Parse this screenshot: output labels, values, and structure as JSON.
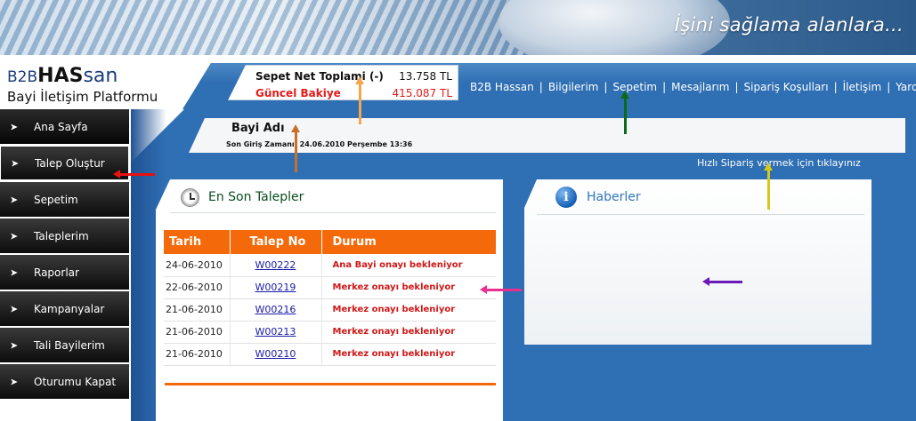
{
  "banner": {
    "slogan": "İşini sağlama alanlara..."
  },
  "logo": {
    "prefix": "B2B",
    "brand_bold": "HAS",
    "brand_light": "san",
    "subtitle": "Bayi İletişim Platformu"
  },
  "cart": {
    "net_total_label": "Sepet Net Toplami (-)",
    "net_total_value": "13.758 TL",
    "balance_label": "Güncel Bakiye",
    "balance_value": "415.087 TL"
  },
  "topnav": {
    "items": [
      "B2B Hassan",
      "Bilgilerim",
      "Sepetim",
      "Mesajlarım",
      "Sipariş Koşulları",
      "İletişim",
      "Yardım"
    ],
    "separator": "|"
  },
  "sidebar": {
    "items": [
      {
        "label": "Ana Sayfa"
      },
      {
        "label": "Talep Oluştur"
      },
      {
        "label": "Sepetim"
      },
      {
        "label": "Taleplerim"
      },
      {
        "label": "Raporlar"
      },
      {
        "label": "Kampanyalar"
      },
      {
        "label": "Tali Bayilerim"
      },
      {
        "label": "Oturumu Kapat"
      }
    ]
  },
  "dealer": {
    "name": "Bayi Adı",
    "last_login": "Son Giriş Zamanı: 24.06.2010 Perşembe 13:36"
  },
  "quick_order_hint": "Hızlı Sipariş vermek için tıklayınız",
  "requests_panel": {
    "title": "En Son Talepler",
    "columns": [
      "Tarih",
      "Talep No",
      "Durum"
    ],
    "rows": [
      {
        "date": "24-06-2010",
        "no": "W00222",
        "status": "Ana Bayi onayı bekleniyor"
      },
      {
        "date": "22-06-2010",
        "no": "W00219",
        "status": "Merkez onayı bekleniyor"
      },
      {
        "date": "21-06-2010",
        "no": "W00216",
        "status": "Merkez onayı bekleniyor"
      },
      {
        "date": "21-06-2010",
        "no": "W00213",
        "status": "Merkez onayı bekleniyor"
      },
      {
        "date": "21-06-2010",
        "no": "W00210",
        "status": "Merkez onayı bekleniyor"
      }
    ]
  },
  "news_panel": {
    "title": "Haberler"
  },
  "colors": {
    "header_blue": "#2f6fb3",
    "table_header_orange": "#f46a0a",
    "status_red": "#d01717",
    "balance_red": "#e31b1b",
    "annotation_red": "#e81010",
    "annotation_orange_light": "#f5a54a",
    "annotation_orange_dark": "#c8702a",
    "annotation_green": "#0b6b1a",
    "annotation_yellow": "#d4c81a",
    "annotation_pink": "#e8308e",
    "annotation_purple": "#6a1ab8"
  }
}
